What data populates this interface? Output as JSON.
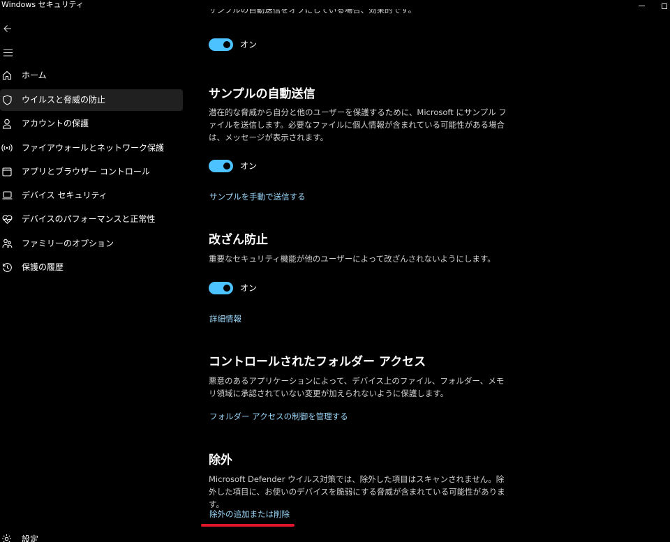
{
  "window": {
    "title": "Windows セキュリティ"
  },
  "sidebar": {
    "items": [
      {
        "label": "ホーム",
        "icon": "home-icon"
      },
      {
        "label": "ウイルスと脅威の防止",
        "icon": "shield-icon",
        "active": true
      },
      {
        "label": "アカウントの保護",
        "icon": "person-icon"
      },
      {
        "label": "ファイアウォールとネットワーク保護",
        "icon": "wireless-icon"
      },
      {
        "label": "アプリとブラウザー コントロール",
        "icon": "app-window-icon"
      },
      {
        "label": "デバイス セキュリティ",
        "icon": "laptop-icon"
      },
      {
        "label": "デバイスのパフォーマンスと正常性",
        "icon": "heart-pulse-icon"
      },
      {
        "label": "ファミリーのオプション",
        "icon": "family-icon"
      },
      {
        "label": "保護の履歴",
        "icon": "history-icon"
      }
    ],
    "settings_label": "設定"
  },
  "content": {
    "top_partial_text": "サンプルの自動送信をオフにしている場合、効果的です。",
    "toggle1_label": "オン",
    "sample_submission": {
      "title": "サンプルの自動送信",
      "description": "潜在的な脅威から自分と他のユーザーを保護するために、Microsoft にサンプル ファイルを送信します。必要なファイルに個人情報が含まれている可能性がある場合は、メッセージが表示されます。",
      "toggle_label": "オン",
      "link": "サンプルを手動で送信する"
    },
    "tamper_protection": {
      "title": "改ざん防止",
      "description": "重要なセキュリティ機能が他のユーザーによって改ざんされないようにします。",
      "toggle_label": "オン",
      "link": "詳細情報"
    },
    "controlled_folder": {
      "title": "コントロールされたフォルダー アクセス",
      "description": "悪意のあるアプリケーションによって、デバイス上のファイル、フォルダー、メモリ領域に承認されていない変更が加えられないように保護します。",
      "link": "フォルダー アクセスの制御を管理する"
    },
    "exclusions": {
      "title": "除外",
      "description": "Microsoft Defender ウイルス対策では、除外した項目はスキャンされません。除外した項目に、お使いのデバイスを脆弱にする脅威が含まれている可能性があります。",
      "link": "除外の追加または削除"
    }
  },
  "colors": {
    "background": "#000000",
    "accent_toggle": "#4cc2ff",
    "link": "#99d5f8",
    "annotation_underline": "#e0152a",
    "active_nav_bg": "#202020"
  }
}
